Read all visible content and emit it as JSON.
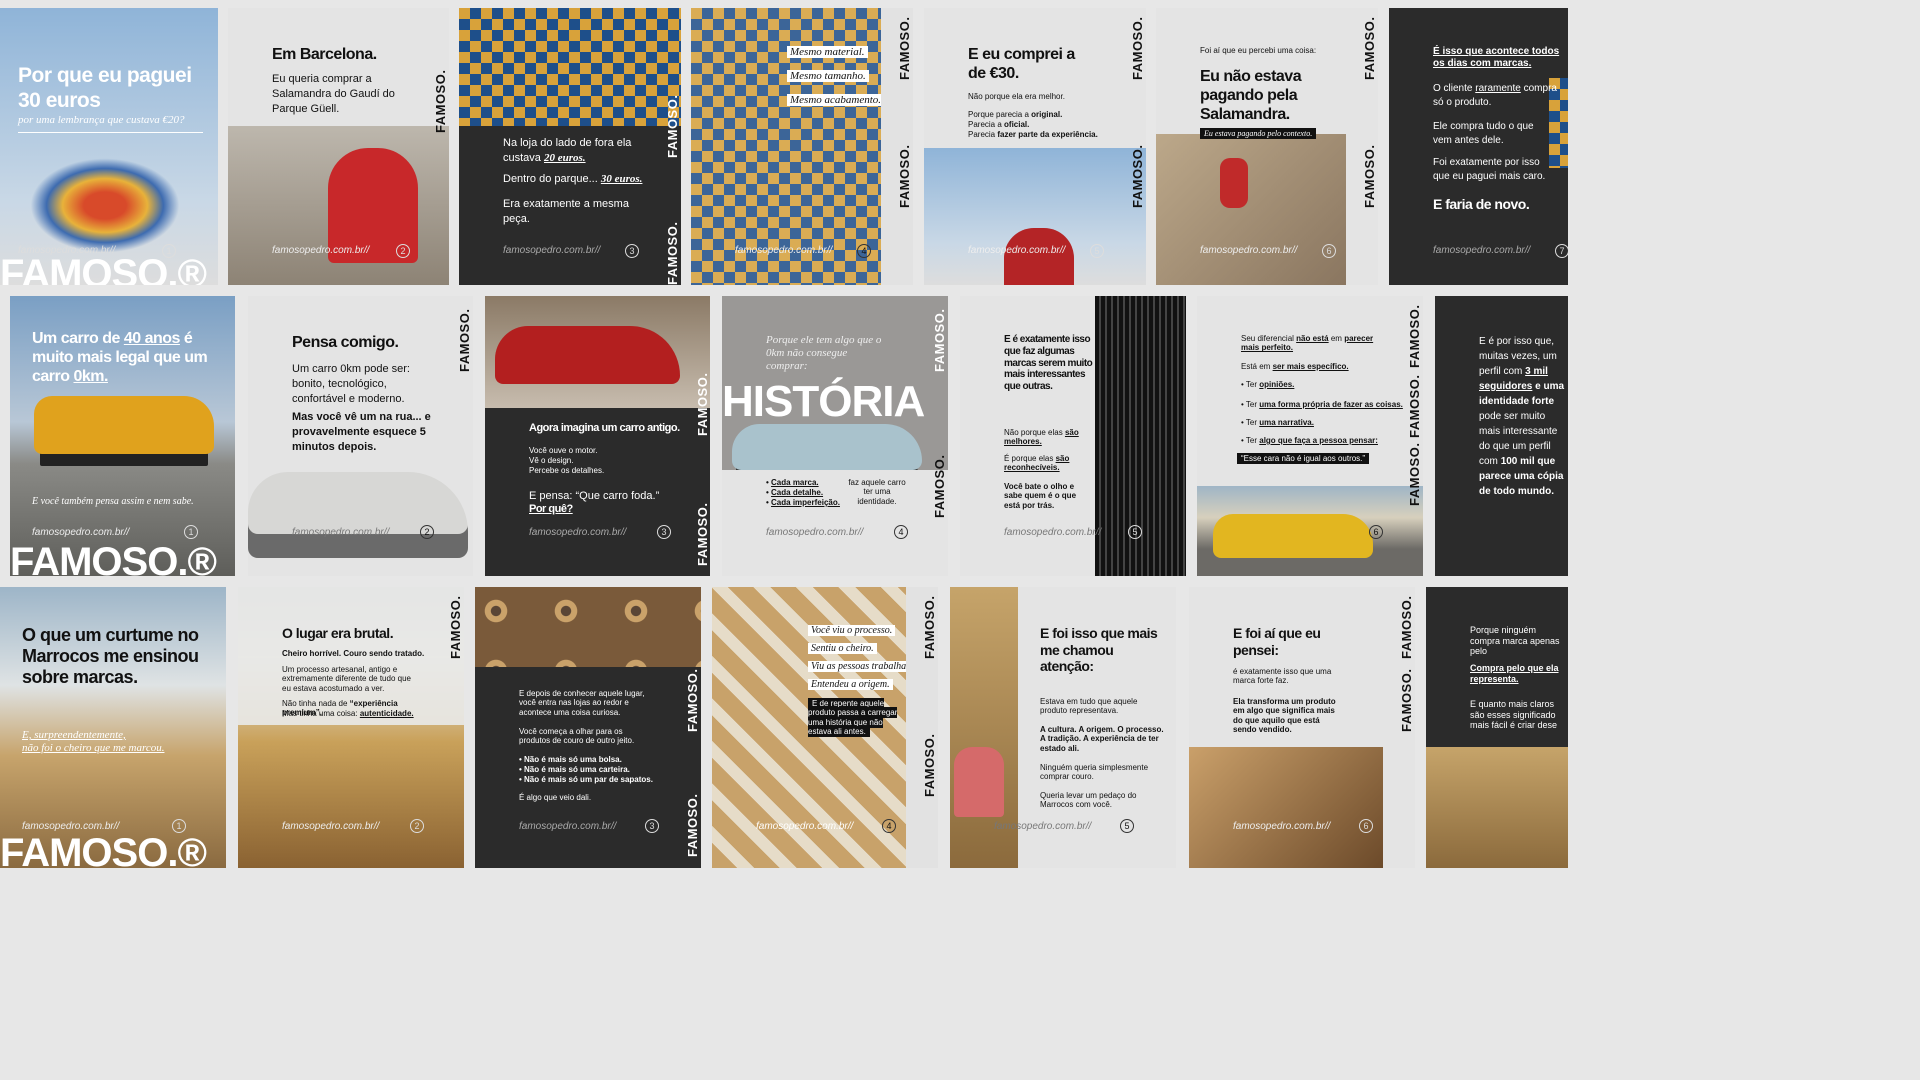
{
  "brand": "FAMOSO.",
  "brand_reg": "FAMOSO.®",
  "url": "famosopedro.com.br//",
  "row1": {
    "c1": {
      "title": "Por que eu paguei 30 euros",
      "sub": "por uma lembrança que custava €20?",
      "num": "1"
    },
    "c2": {
      "title": "Em Barcelona.",
      "body": "Eu queria comprar a Salamandra do Gaudí do Parque Güell.",
      "num": "2"
    },
    "c3": {
      "p1": "Na loja do lado de fora ela custava",
      "p1b": "20 euros.",
      "p2": "Dentro do parque...",
      "p2b": "30 euros.",
      "p3": "Era exatamente a mesma peça.",
      "num": "3"
    },
    "c4": {
      "l1": "Mesmo material.",
      "l2": "Mesmo tamanho.",
      "l3": "Mesmo acabamento.",
      "num": "4"
    },
    "c5": {
      "title": "E eu comprei a de €30.",
      "l1": "Não porque ela era melhor.",
      "l2a": "Porque parecia a",
      "l2b": "original.",
      "l3a": "Parecia a",
      "l3b": "oficial.",
      "l4a": "Parecia",
      "l4b": "fazer parte da experiência.",
      "num": "5"
    },
    "c6": {
      "kicker": "Foi aí que eu percebi uma coisa:",
      "title": "Eu não estava pagando pela Salamandra.",
      "tag": "Eu estava pagando pelo contexto.",
      "num": "6"
    },
    "c7": {
      "l1": "É isso que acontece todos os dias com marcas.",
      "l2a": "O cliente",
      "l2b": "raramente",
      "l2c": "compra só o produto.",
      "l3": "Ele compra tudo o que vem antes dele.",
      "l4": "Foi exatamente por isso que eu paguei mais caro.",
      "end": "E faria de novo.",
      "num": "7"
    }
  },
  "row2": {
    "c1": {
      "title_a": "Um carro de",
      "title_b": "40 anos",
      "title_c": "é muito mais legal que um carro",
      "title_d": "0km.",
      "sub": "E você também pensa assim e nem sabe.",
      "num": "1"
    },
    "c2": {
      "title": "Pensa comigo.",
      "p1": "Um carro 0km pode ser: bonito, tecnológico, confortável e moderno.",
      "p2": "Mas você vê um na rua... e provavelmente esquece 5 minutos depois.",
      "num": "2"
    },
    "c3": {
      "title": "Agora imagina um carro antigo.",
      "p1": "Você ouve o motor.",
      "p2": "Vê o design.",
      "p3": "Percebe os detalhes.",
      "p4": "E pensa: “Que carro foda.”",
      "q": "Por quê?",
      "num": "3"
    },
    "c4": {
      "intro": "Porque ele tem algo que o 0km não consegue comprar:",
      "big": "HISTÓRIA",
      "b1": "Cada marca.",
      "b2": "Cada detalhe.",
      "b3": "Cada imperfeição.",
      "side": "faz aquele carro ter uma identidade.",
      "num": "4"
    },
    "c5": {
      "title": "E é exatamente isso que faz algumas marcas serem muito mais interessantes que outras.",
      "p1a": "Não porque elas",
      "p1b": "são melhores.",
      "p2a": "É porque elas",
      "p2b": "são reconhecíveis.",
      "p3": "Você bate o olho e sabe quem é o que está por trás.",
      "num": "5"
    },
    "c6": {
      "l1a": "Seu diferencial",
      "l1b": "não está",
      "l1c": "em",
      "l1d": "parecer mais perfeito.",
      "l2a": "Está em",
      "l2b": "ser mais específico.",
      "b1a": "Ter",
      "b1b": "opiniões.",
      "b2a": "Ter",
      "b2b": "uma forma própria de fazer as coisas.",
      "b3a": "Ter",
      "b3b": "uma narrativa.",
      "b4a": "Ter",
      "b4b": "algo que faça a pessoa pensar:",
      "quote": "“Esse cara não é igual aos outros.”",
      "num": "6"
    },
    "c7": {
      "p1": "E é por isso que, muitas vezes, um perfil com",
      "p1b": "3 mil seguidores",
      "p2": "e uma identidade forte",
      "p3": "pode ser muito mais interessante do que um perfil com",
      "p4": "100 mil",
      "p5": "que parece uma cópia de todo mundo."
    }
  },
  "row3": {
    "c1": {
      "title": "O que um curtume no Marrocos me ensinou sobre marcas.",
      "sub1": "E, surpreendentemente,",
      "sub2": "não foi o cheiro que me marcou.",
      "num": "1"
    },
    "c2": {
      "title": "O lugar era brutal.",
      "p1": "Cheiro horrível. Couro sendo tratado.",
      "p2": "Um processo artesanal, antigo e extremamente diferente de tudo que eu estava acostumado a ver.",
      "p3a": "Não tinha nada de",
      "p3b": "“experiência premium”.",
      "p4a": "Mas tinha uma coisa:",
      "p4b": "autenticidade.",
      "num": "2"
    },
    "c3": {
      "p1": "E depois de conhecer aquele lugar, você entra nas lojas ao redor e acontece uma coisa curiosa.",
      "p2": "Você começa a olhar para os produtos de couro de outro jeito.",
      "b1": "Não é mais só uma bolsa.",
      "b2": "Não é mais só uma carteira.",
      "b3": "Não é mais só um par de sapatos.",
      "p3": "É algo que veio dali.",
      "num": "3"
    },
    "c4": {
      "l1": "Você viu o processo.",
      "l2": "Sentiu o cheiro.",
      "l3": "Viu as pessoas trabalhando.",
      "l4": "Entendeu a origem.",
      "l5": "E de repente aquele produto passa a carregar uma história que não estava ali antes.",
      "num": "4"
    },
    "c5": {
      "title": "E foi isso que mais me chamou atenção:",
      "p1": "Estava em tudo que aquele produto representava.",
      "p2": "A cultura. A origem. O processo. A tradição. A experiência de ter estado ali.",
      "p3": "Ninguém queria simplesmente comprar couro.",
      "p4": "Queria levar um pedaço do Marrocos com você.",
      "num": "5"
    },
    "c6": {
      "title": "E foi aí que eu pensei:",
      "p1": "é exatamente isso que uma marca forte faz.",
      "p2": "Ela transforma um produto em algo que significa mais do que aquilo que está sendo vendido.",
      "num": "6"
    },
    "c7": {
      "p1": "Porque ninguém compra marca apenas pelo",
      "p2": "Compra pelo que ela representa.",
      "p3": "E quanto mais claros são esses significado mais fácil é criar dese"
    }
  }
}
